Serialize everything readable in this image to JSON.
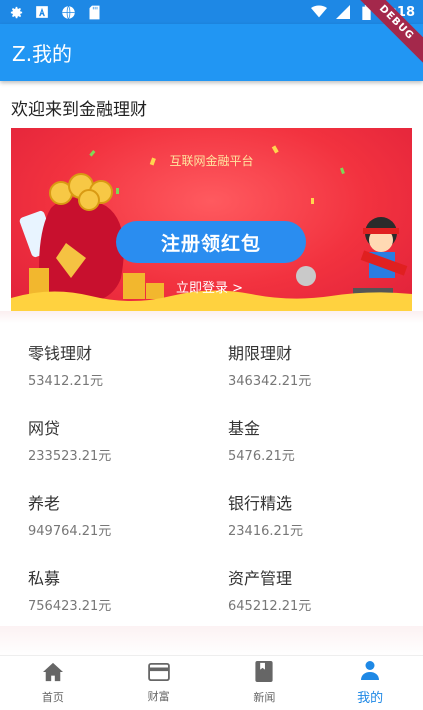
{
  "status_bar": {
    "time": "2:18",
    "icons": [
      "gear-icon",
      "font-icon",
      "globe-icon",
      "sd-card-icon",
      "wifi-icon",
      "signal-icon",
      "battery-icon"
    ]
  },
  "debug_label": "DEBUG",
  "app_bar": {
    "title": "Z.我的"
  },
  "welcome": "欢迎来到金融理财",
  "banner": {
    "subtitle": "互联网金融平台",
    "button_label": "注册领红包",
    "login_link": "立即登录 >"
  },
  "grid": [
    {
      "title": "零钱理财",
      "value": "53412.21元"
    },
    {
      "title": "期限理财",
      "value": "346342.21元"
    },
    {
      "title": "网贷",
      "value": "233523.21元"
    },
    {
      "title": "基金",
      "value": "5476.21元"
    },
    {
      "title": "养老",
      "value": "949764.21元"
    },
    {
      "title": "银行精选",
      "value": "23416.21元"
    },
    {
      "title": "私募",
      "value": "756423.21元"
    },
    {
      "title": "资产管理",
      "value": "645212.21元"
    }
  ],
  "nav": [
    {
      "label": "首页",
      "icon": "home-icon"
    },
    {
      "label": "财富",
      "icon": "credit-card-icon"
    },
    {
      "label": "新闻",
      "icon": "book-icon"
    },
    {
      "label": "我的",
      "icon": "person-icon",
      "active": true
    }
  ],
  "colors": {
    "primary": "#2196f3",
    "status_bar": "#1e88e5",
    "banner_red": "#f2323f",
    "active": "#1e88e5"
  }
}
